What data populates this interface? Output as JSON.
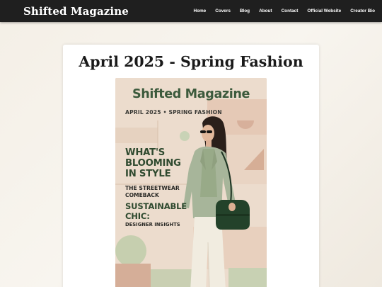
{
  "site": {
    "title": "Shifted Magazine"
  },
  "nav": {
    "items": [
      "Home",
      "Covers",
      "Blog",
      "About",
      "Contact",
      "Official Website",
      "Creator Bio"
    ]
  },
  "article": {
    "title": "April 2025 - Spring Fashion"
  },
  "cover": {
    "masthead": "Shifted Magazine",
    "issue": "APRIL 2025 • SPRING FASHION",
    "headline": [
      "WHAT'S",
      "BLOOMING",
      "IN STYLE"
    ],
    "sub_1": [
      "THE STREETWEAR",
      "COMEBACK"
    ],
    "sub_2": [
      "SUSTAINABLE",
      "CHIC:"
    ],
    "sub_3": "DESIGNER INSIGHTS"
  },
  "colors": {
    "navbar": "#1f1f1f",
    "cover_green": "#3c5a3c",
    "cover_background": "#ead8c8"
  }
}
